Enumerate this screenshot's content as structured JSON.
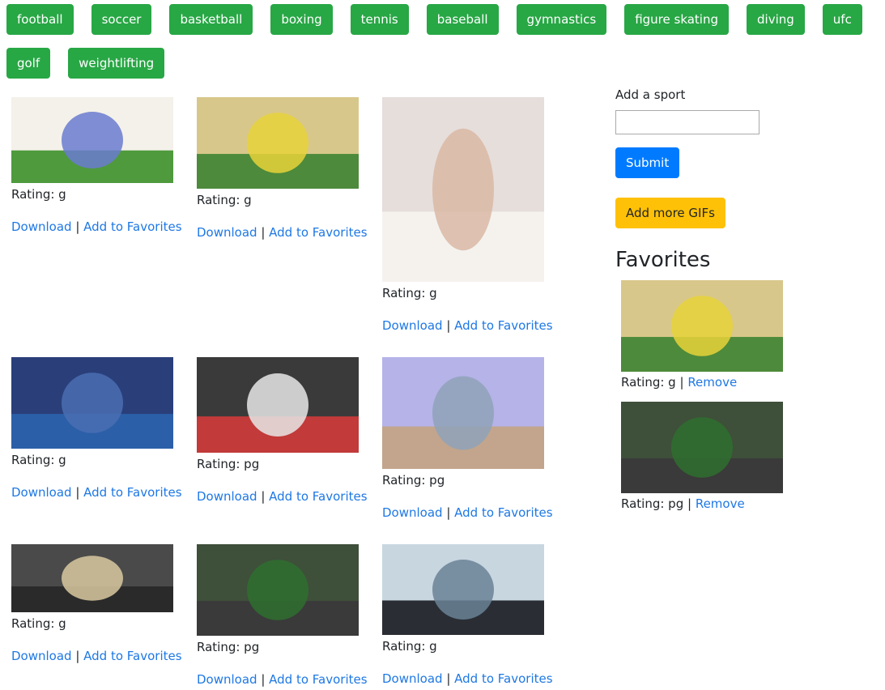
{
  "topics": [
    "football",
    "soccer",
    "basketball",
    "boxing",
    "tennis",
    "baseball",
    "gymnastics",
    "figure skating",
    "diving",
    "ufc",
    "golf",
    "weightlifting"
  ],
  "gifs": [
    {
      "rating": "Rating: g",
      "download": "Download",
      "favorite": "Add to Favorites",
      "image": "Animated football player in purple jersey dancing on a football field",
      "colors": [
        "#f4f1ea",
        "#6a7bd0",
        "#4f9a3d"
      ]
    },
    {
      "rating": "Rating: g",
      "download": "Download",
      "favorite": "Add to Favorites",
      "image": "Minions in red football helmets in a stadium",
      "colors": [
        "#d8c78a",
        "#e8d23a",
        "#4d8a3b"
      ]
    },
    {
      "rating": "Rating: g",
      "download": "Download",
      "favorite": "Add to Favorites",
      "image": "Man in white shirt dancing",
      "colors": [
        "#e6dedb",
        "#d9b8a4",
        "#f5f2ee"
      ]
    },
    {
      "rating": "Rating: g",
      "download": "Download",
      "favorite": "Add to Favorites",
      "image": "Football player celebrating on blue stadium field",
      "colors": [
        "#2a3f7a",
        "#4a6fb3",
        "#2b5fa8"
      ]
    },
    {
      "rating": "Rating: pg",
      "download": "Download",
      "favorite": "Add to Favorites",
      "image": "Coach with headset on sideline",
      "colors": [
        "#3a3a3a",
        "#e8e8e8",
        "#c23a3a"
      ]
    },
    {
      "rating": "Rating: pg",
      "download": "Download",
      "favorite": "Add to Favorites",
      "image": "Woman on beach holding a football",
      "colors": [
        "#b5b3e8",
        "#8fa2b8",
        "#c2a58c"
      ]
    },
    {
      "rating": "Rating: g",
      "download": "Download",
      "favorite": "Add to Favorites",
      "image": "Broadcasters in suits reacting",
      "colors": [
        "#4a4a4a",
        "#d9c9a0",
        "#2a2a2a"
      ]
    },
    {
      "rating": "Rating: pg",
      "download": "Download",
      "favorite": "Add to Favorites",
      "image": "Football play on Falcons field",
      "colors": [
        "#3e4f3a",
        "#2f6e2f",
        "#3a3a3a"
      ]
    },
    {
      "rating": "Rating: g",
      "download": "Download",
      "favorite": "Add to Favorites",
      "image": "Coach with glasses and beard in front of screen",
      "colors": [
        "#c8d6e0",
        "#6a8296",
        "#2a2e34"
      ]
    }
  ],
  "sidebar": {
    "add_label": "Add a sport",
    "input_value": "",
    "submit": "Submit",
    "more_gifs": "Add more GIFs",
    "favorites_title": "Favorites"
  },
  "favorites": [
    {
      "rating": "Rating: g",
      "remove": "Remove",
      "image": "Minions in red football helmets in a stadium",
      "colors": [
        "#d8c78a",
        "#e8d23a",
        "#4d8a3b"
      ]
    },
    {
      "rating": "Rating: pg",
      "remove": "Remove",
      "image": "Football play on Falcons field",
      "colors": [
        "#3e4f3a",
        "#2f6e2f",
        "#3a3a3a"
      ]
    }
  ],
  "colors": {
    "topic_button": "#28a745",
    "submit_button": "#007bff",
    "more_button": "#ffc107",
    "link": "#1e78e4"
  }
}
